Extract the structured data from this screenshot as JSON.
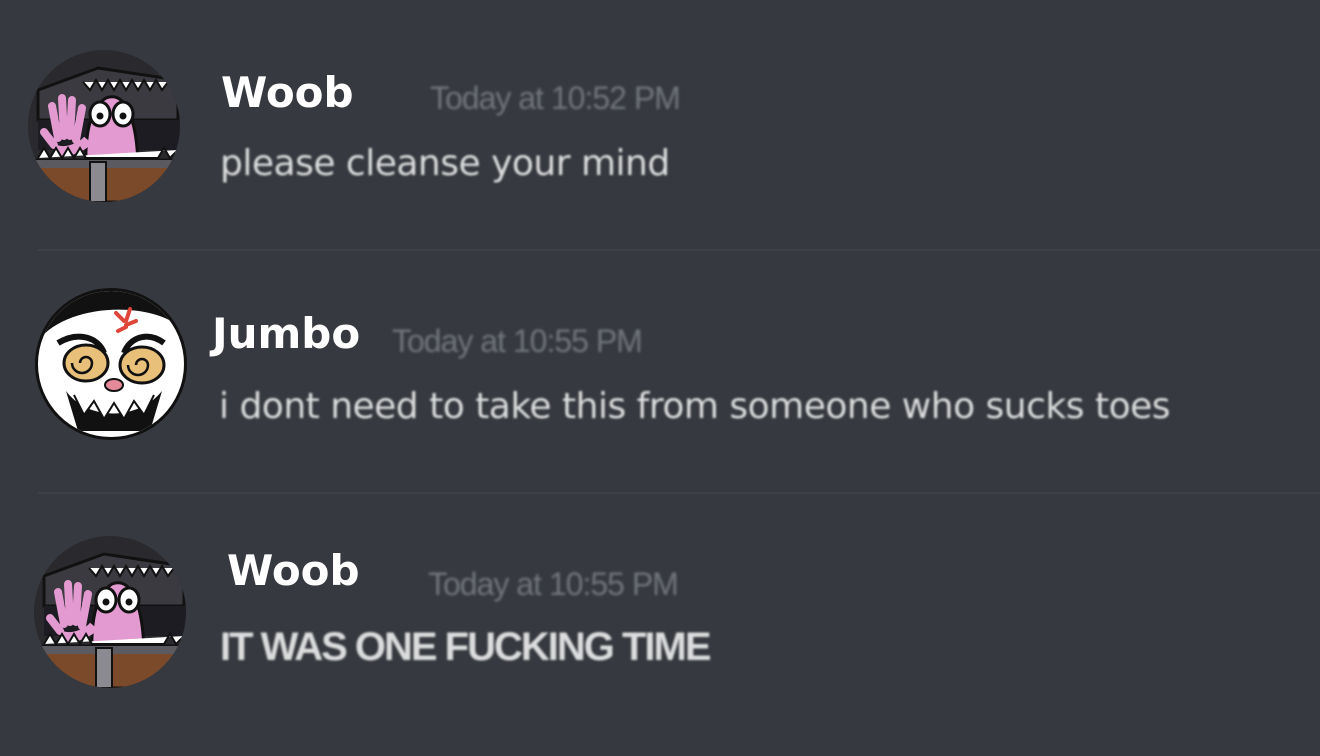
{
  "messages": [
    {
      "author": "Woob",
      "timestamp": "Today at 10:52 PM",
      "text": "please cleanse your mind",
      "avatar_icon": "mimic-chest-avatar-icon"
    },
    {
      "author": "Jumbo",
      "timestamp": "Today at 10:55 PM",
      "text": "i dont need to take this from someone who sucks toes",
      "avatar_icon": "angry-face-avatar-icon"
    },
    {
      "author": "Woob",
      "timestamp": "Today at 10:55 PM",
      "text": "IT WAS ONE FUCKING TIME",
      "avatar_icon": "mimic-chest-avatar-icon"
    }
  ],
  "colors": {
    "background": "#36393f",
    "username": "#ffffff",
    "timestamp": "#72767d",
    "message_text": "#dcddde",
    "divider": "#3e4147"
  }
}
